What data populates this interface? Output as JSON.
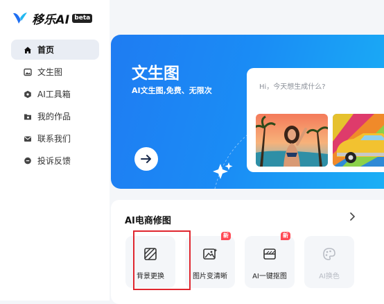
{
  "brand": {
    "name": "移乐AI",
    "badge": "beta"
  },
  "sidebar": {
    "items": [
      {
        "label": "首页",
        "icon": "home-icon",
        "active": true
      },
      {
        "label": "文生图",
        "icon": "image-icon",
        "active": false
      },
      {
        "label": "AI工具箱",
        "icon": "toolbox-icon",
        "active": false
      },
      {
        "label": "我的作品",
        "icon": "folder-icon",
        "active": false
      },
      {
        "label": "联系我们",
        "icon": "mail-icon",
        "active": false
      },
      {
        "label": "投诉反馈",
        "icon": "feedback-icon",
        "active": false
      }
    ]
  },
  "hero": {
    "title": "文生图",
    "subtitle": "AI文生图,免费、无限次",
    "prompt_placeholder": "Hi，今天想生成什么?",
    "accent": "#1a8cf5"
  },
  "ecommerce": {
    "title": "AI电商修图",
    "more_icon": "chevron-right-icon",
    "tools": [
      {
        "label": "背景更换",
        "icon": "background-swap-icon",
        "badge": "",
        "enabled": true
      },
      {
        "label": "图片变清晰",
        "icon": "image-enhance-icon",
        "badge": "新",
        "enabled": true
      },
      {
        "label": "AI一键抠图",
        "icon": "cutout-icon",
        "badge": "新",
        "enabled": true
      },
      {
        "label": "AI换色",
        "icon": "palette-icon",
        "badge": "",
        "enabled": false
      }
    ]
  }
}
